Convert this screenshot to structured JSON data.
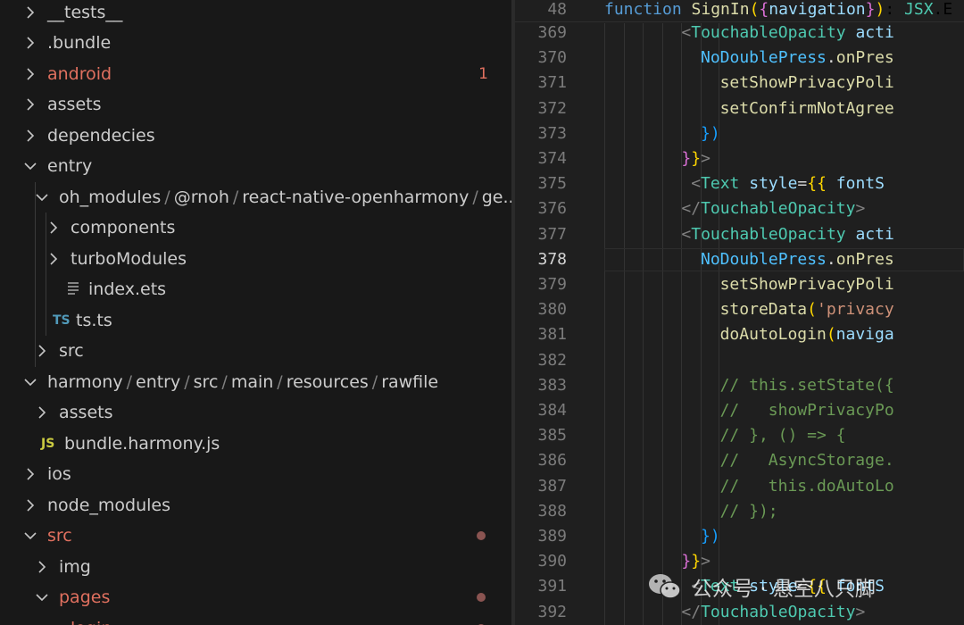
{
  "explorer": {
    "items": [
      {
        "label": "__tests__",
        "expanded": false,
        "depth": 0
      },
      {
        "label": ".bundle",
        "expanded": false,
        "depth": 0
      },
      {
        "label": "android",
        "expanded": false,
        "depth": 0,
        "git": true,
        "badge": "1"
      },
      {
        "label": "assets",
        "expanded": false,
        "depth": 0
      },
      {
        "label": "dependecies",
        "expanded": false,
        "depth": 0
      },
      {
        "label": "entry",
        "expanded": true,
        "depth": 0
      },
      {
        "path": [
          "oh_modules",
          "@rnoh",
          "react-native-openharmony",
          "ge..."
        ],
        "expanded": true,
        "depth": 1
      },
      {
        "label": "components",
        "expanded": false,
        "depth": 2
      },
      {
        "label": "turboModules",
        "expanded": false,
        "depth": 2
      },
      {
        "label": "index.ets",
        "file": true,
        "icon": "lines-file-icon",
        "depth": 2
      },
      {
        "label": "ts.ts",
        "file": true,
        "icon": "typescript-file-icon",
        "icon_text": "TS",
        "icon_color": "#519aba",
        "depth": 2
      },
      {
        "label": "src",
        "expanded": false,
        "depth": 1
      },
      {
        "path": [
          "harmony",
          "entry",
          "src",
          "main",
          "resources",
          "rawfile"
        ],
        "expanded": true,
        "depth": 0
      },
      {
        "label": "assets",
        "expanded": false,
        "depth": 1
      },
      {
        "label": "bundle.harmony.js",
        "file": true,
        "icon": "javascript-file-icon",
        "icon_text": "JS",
        "icon_color": "#cbcb41",
        "depth": 1
      },
      {
        "label": "ios",
        "expanded": false,
        "depth": 0
      },
      {
        "label": "node_modules",
        "expanded": false,
        "depth": 0
      },
      {
        "label": "src",
        "expanded": true,
        "depth": 0,
        "git": true,
        "dot": true
      },
      {
        "label": "img",
        "expanded": false,
        "depth": 1
      },
      {
        "label": "pages",
        "expanded": true,
        "depth": 1,
        "git": true,
        "dot": true
      },
      {
        "label": "login",
        "expanded": true,
        "depth": 2,
        "git": true,
        "dot": true
      }
    ]
  },
  "editor": {
    "sticky": {
      "num": "48",
      "tokens": [
        [
          "function ",
          "kw"
        ],
        [
          "SignIn",
          "fn"
        ],
        [
          "(",
          "b1"
        ],
        [
          "{",
          "b2"
        ],
        [
          "navigation",
          "var"
        ],
        [
          "}",
          "b2"
        ],
        [
          ")",
          "b1"
        ],
        [
          ": ",
          "p0"
        ],
        [
          "JSX",
          "type"
        ],
        [
          ".E",
          "p0"
        ]
      ]
    },
    "active_line": 378,
    "lines": [
      {
        "num": "369",
        "indent": 8,
        "tokens": [
          [
            "<",
            "p"
          ],
          [
            "TouchableOpacity",
            "type"
          ],
          [
            " ",
            "p0"
          ],
          [
            "acti",
            "var"
          ]
        ]
      },
      {
        "num": "370",
        "indent": 10,
        "tokens": [
          [
            "NoDoublePress",
            "obj"
          ],
          [
            ".",
            "p0"
          ],
          [
            "onPres",
            "fn"
          ]
        ]
      },
      {
        "num": "371",
        "indent": 12,
        "tokens": [
          [
            "setShowPrivacyPoli",
            "fn"
          ]
        ]
      },
      {
        "num": "372",
        "indent": 12,
        "tokens": [
          [
            "setConfirmNotAgree",
            "fn"
          ]
        ]
      },
      {
        "num": "373",
        "indent": 10,
        "tokens": [
          [
            "})",
            "b3"
          ]
        ]
      },
      {
        "num": "374",
        "indent": 8,
        "tokens": [
          [
            "}",
            "b2"
          ],
          [
            "}",
            "b1"
          ],
          [
            ">",
            "p"
          ]
        ]
      },
      {
        "num": "375",
        "indent": 9,
        "tokens": [
          [
            "<",
            "p"
          ],
          [
            "Text",
            "type"
          ],
          [
            " ",
            "p0"
          ],
          [
            "style",
            "var"
          ],
          [
            "=",
            "p0"
          ],
          [
            "{{",
            "b1"
          ],
          [
            " ",
            "p0"
          ],
          [
            "fontS",
            "var"
          ]
        ]
      },
      {
        "num": "376",
        "indent": 8,
        "tokens": [
          [
            "</",
            "p"
          ],
          [
            "TouchableOpacity",
            "type"
          ],
          [
            ">",
            "p"
          ]
        ]
      },
      {
        "num": "377",
        "indent": 8,
        "tokens": [
          [
            "<",
            "p"
          ],
          [
            "TouchableOpacity",
            "type"
          ],
          [
            " ",
            "p0"
          ],
          [
            "acti",
            "var"
          ]
        ]
      },
      {
        "num": "378",
        "indent": 10,
        "tokens": [
          [
            "NoDoublePress",
            "obj"
          ],
          [
            ".",
            "p0"
          ],
          [
            "onPres",
            "fn"
          ]
        ]
      },
      {
        "num": "379",
        "indent": 12,
        "tokens": [
          [
            "setShowPrivacyPoli",
            "fn"
          ]
        ]
      },
      {
        "num": "380",
        "indent": 12,
        "tokens": [
          [
            "storeData",
            "fn"
          ],
          [
            "(",
            "b1"
          ],
          [
            "'privacy",
            "str"
          ]
        ]
      },
      {
        "num": "381",
        "indent": 12,
        "tokens": [
          [
            "doAutoLogin",
            "fn"
          ],
          [
            "(",
            "b1"
          ],
          [
            "naviga",
            "var"
          ]
        ]
      },
      {
        "num": "382",
        "indent": 12,
        "tokens": []
      },
      {
        "num": "383",
        "indent": 12,
        "tokens": [
          [
            "// this.setState({",
            "cm"
          ]
        ]
      },
      {
        "num": "384",
        "indent": 12,
        "tokens": [
          [
            "//   showPrivacyPo",
            "cm"
          ]
        ]
      },
      {
        "num": "385",
        "indent": 12,
        "tokens": [
          [
            "// }, () => {",
            "cm"
          ]
        ]
      },
      {
        "num": "386",
        "indent": 12,
        "tokens": [
          [
            "//   AsyncStorage.",
            "cm"
          ]
        ]
      },
      {
        "num": "387",
        "indent": 12,
        "tokens": [
          [
            "//   this.doAutoLo",
            "cm"
          ]
        ]
      },
      {
        "num": "388",
        "indent": 12,
        "tokens": [
          [
            "// });",
            "cm"
          ]
        ]
      },
      {
        "num": "389",
        "indent": 10,
        "tokens": [
          [
            "})",
            "b3"
          ]
        ]
      },
      {
        "num": "390",
        "indent": 8,
        "tokens": [
          [
            "}",
            "b2"
          ],
          [
            "}",
            "b1"
          ],
          [
            ">",
            "p"
          ]
        ]
      },
      {
        "num": "391",
        "indent": 9,
        "tokens": [
          [
            "<",
            "p"
          ],
          [
            "Text",
            "type"
          ],
          [
            " ",
            "p0"
          ],
          [
            "style",
            "var"
          ],
          [
            "=",
            "p0"
          ],
          [
            "{{",
            "b1"
          ],
          [
            " ",
            "p0"
          ],
          [
            "fontS",
            "var"
          ]
        ]
      },
      {
        "num": "392",
        "indent": 8,
        "tokens": [
          [
            "</",
            "p"
          ],
          [
            "TouchableOpacity",
            "type"
          ],
          [
            ">",
            "p"
          ]
        ]
      }
    ]
  },
  "watermark": {
    "text": "公众号 · 悬空八只脚"
  },
  "colors": {
    "git_modified": "#e0705f",
    "line_number": "#7b7b7b",
    "active_line_number": "#d4d4d4"
  }
}
